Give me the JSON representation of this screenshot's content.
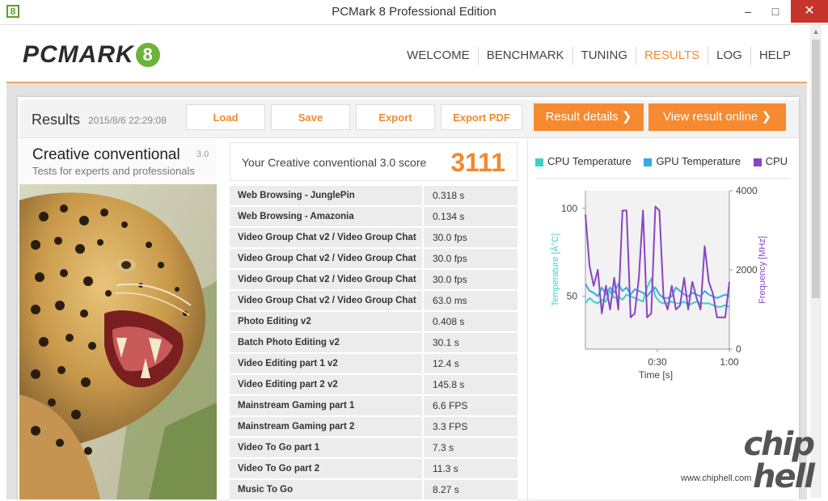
{
  "window": {
    "title": "PCMark 8 Professional Edition",
    "icon_label": "8",
    "minimize": "–",
    "maximize": "□",
    "close": "✕"
  },
  "header": {
    "logo_text": "PCMARK",
    "logo_mark": "8",
    "nav": [
      "WELCOME",
      "BENCHMARK",
      "TUNING",
      "RESULTS",
      "LOG",
      "HELP"
    ],
    "active_nav": "RESULTS"
  },
  "results_bar": {
    "title": "Results",
    "date": "2015/8/6 22:29:08",
    "buttons": {
      "load": "Load",
      "save": "Save",
      "export": "Export",
      "export_pdf": "Export PDF",
      "result_details": "Result details",
      "view_online": "View result online"
    },
    "accent_color": "#f58a30"
  },
  "test": {
    "name": "Creative conventional",
    "version": "3.0",
    "subtitle": "Tests for experts and professionals"
  },
  "score": {
    "label": "Your Creative conventional 3.0 score",
    "value": "3111"
  },
  "results": [
    {
      "name": "Web Browsing - JunglePin",
      "value": "0.318 s"
    },
    {
      "name": "Web Browsing - Amazonia",
      "value": "0.134 s"
    },
    {
      "name": "Video Group Chat v2 / Video Group Chat",
      "value": "30.0 fps"
    },
    {
      "name": "Video Group Chat v2 / Video Group Chat",
      "value": "30.0 fps"
    },
    {
      "name": "Video Group Chat v2 / Video Group Chat",
      "value": "30.0 fps"
    },
    {
      "name": "Video Group Chat v2 / Video Group Chat",
      "value": "63.0 ms"
    },
    {
      "name": "Photo Editing v2",
      "value": "0.408 s"
    },
    {
      "name": "Batch Photo Editing v2",
      "value": "30.1 s"
    },
    {
      "name": "Video Editing part 1 v2",
      "value": "12.4 s"
    },
    {
      "name": "Video Editing part 2 v2",
      "value": "145.8 s"
    },
    {
      "name": "Mainstream Gaming part 1",
      "value": "6.6 FPS"
    },
    {
      "name": "Mainstream Gaming part 2",
      "value": "3.3 FPS"
    },
    {
      "name": "Video To Go part 1",
      "value": "7.3 s"
    },
    {
      "name": "Video To Go part 2",
      "value": "11.3 s"
    },
    {
      "name": "Music To Go",
      "value": "8.27 s"
    }
  ],
  "monitor_chart": {
    "legend": [
      {
        "name": "CPU Temperature",
        "color": "#3ecfc8"
      },
      {
        "name": "GPU Temperature",
        "color": "#3aa7e6"
      },
      {
        "name": "CPU Clo",
        "color": "#8a44c2"
      }
    ],
    "left_axis_label": "Temperature [Â°C]",
    "right_axis_label": "Frequency [MHz]",
    "x_axis_label": "Time [s]",
    "left_ticks": [
      "100",
      "50"
    ],
    "right_ticks": [
      "4000",
      "2000",
      "0"
    ],
    "x_ticks": [
      "0:30",
      "1:00"
    ],
    "cpu_temp": [
      46,
      49,
      47,
      46,
      48,
      47,
      53,
      49,
      50,
      48,
      51,
      50,
      49,
      48,
      47,
      55,
      60,
      50,
      47,
      46,
      46,
      47,
      46,
      46,
      47,
      45,
      46,
      47,
      46,
      46,
      46,
      45,
      44,
      44,
      45,
      44
    ],
    "gpu_temp": [
      57,
      53,
      52,
      50,
      55,
      51,
      55,
      52,
      57,
      53,
      55,
      51,
      54,
      53,
      52,
      50,
      53,
      55,
      51,
      49,
      49,
      50,
      55,
      53,
      51,
      50,
      52,
      51,
      50,
      53,
      51,
      50,
      49,
      50,
      51,
      50
    ],
    "cpu_clock": [
      3400,
      2100,
      1600,
      2000,
      900,
      1600,
      1000,
      1800,
      1000,
      3500,
      3500,
      800,
      900,
      1800,
      3500,
      800,
      900,
      3600,
      3500,
      1300,
      1000,
      1600,
      1000,
      1100,
      1800,
      1000,
      1700,
      1300,
      1000,
      2600,
      1700,
      1400,
      800,
      800,
      800,
      1700
    ],
    "temp_range": [
      20,
      110
    ],
    "freq_range": [
      0,
      4000
    ]
  },
  "watermark": {
    "big": "chip hell",
    "url": "www.chiphell.com"
  }
}
